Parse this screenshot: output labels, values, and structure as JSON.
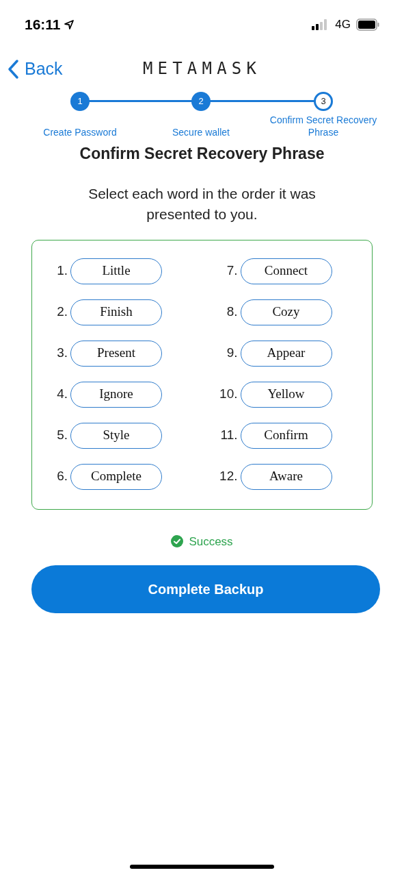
{
  "status_bar": {
    "time": "16:11",
    "network": "4G"
  },
  "header": {
    "back": "Back",
    "logo": "METAMASK"
  },
  "steps": [
    {
      "number": "1",
      "label": "Create Password",
      "completed": true
    },
    {
      "number": "2",
      "label": "Secure wallet",
      "completed": true
    },
    {
      "number": "3",
      "label": "Confirm Secret Recovery Phrase",
      "completed": false
    }
  ],
  "title": "Confirm Secret Recovery Phrase",
  "subtitle": "Select each word in the order it was presented to you.",
  "words": [
    {
      "index": "1.",
      "word": "Little"
    },
    {
      "index": "2.",
      "word": "Finish"
    },
    {
      "index": "3.",
      "word": "Present"
    },
    {
      "index": "4.",
      "word": "Ignore"
    },
    {
      "index": "5.",
      "word": "Style"
    },
    {
      "index": "6.",
      "word": "Complete"
    },
    {
      "index": "7.",
      "word": "Connect"
    },
    {
      "index": "8.",
      "word": "Cozy"
    },
    {
      "index": "9.",
      "word": "Appear"
    },
    {
      "index": "10.",
      "word": "Yellow"
    },
    {
      "index": "11.",
      "word": "Confirm"
    },
    {
      "index": "12.",
      "word": "Aware"
    }
  ],
  "result": {
    "text": "Success",
    "success": true
  },
  "primary_button": "Complete Backup"
}
